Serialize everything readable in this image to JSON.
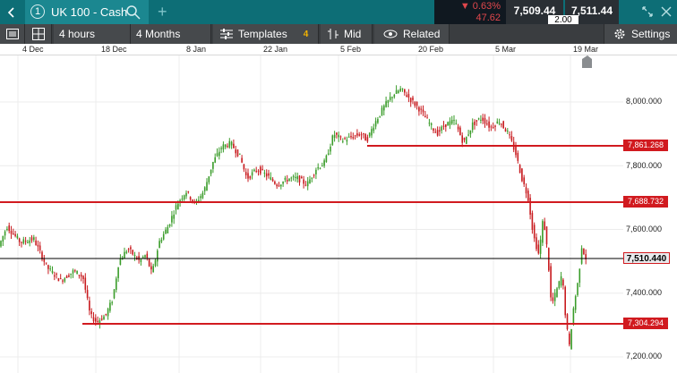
{
  "topbar": {
    "instrument_number": "1",
    "instrument_name": "UK 100 - Cash",
    "change_pct": "▼ 0.63%",
    "change_abs": "47.62",
    "sell_price": "7,509.44",
    "buy_price": "7,511.44",
    "spread": "2.00"
  },
  "toolbar": {
    "interval": "4 hours",
    "range": "4 Months",
    "templates": "Templates",
    "templates_count": "4",
    "price_type": "Mid",
    "related": "Related",
    "settings": "Settings"
  },
  "dates": [
    "4 Dec",
    "18 Dec",
    "8 Jan",
    "22 Jan",
    "5 Feb",
    "20 Feb",
    "5 Mar",
    "19 Mar"
  ],
  "colors": {
    "up": "#3a9c2a",
    "down": "#c81b1f",
    "level": "#d11a1f"
  },
  "chart_data": {
    "type": "candlestick",
    "y_ticks": [
      "8,000.000",
      "7,800.000",
      "7,600.000",
      "7,400.000",
      "7,200.000"
    ],
    "levels": [
      "7,861.268",
      "7,688.732",
      "7,304.294"
    ],
    "current_price": "7,510.440"
  }
}
